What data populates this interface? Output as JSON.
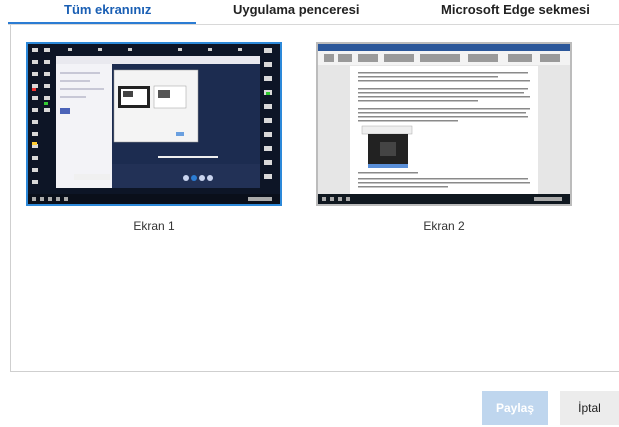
{
  "tabs": [
    {
      "label": "Tüm ekranınız",
      "selected": true
    },
    {
      "label": "Uygulama penceresi",
      "selected": false
    },
    {
      "label": "Microsoft Edge sekmesi",
      "selected": false
    }
  ],
  "screens": [
    {
      "label": "Ekran 1",
      "selected": true
    },
    {
      "label": "Ekran 2",
      "selected": false
    }
  ],
  "buttons": {
    "share_label": "Paylaş",
    "cancel_label": "İptal"
  },
  "colors": {
    "accent": "#2b7cd3",
    "share_disabled": "#bfd6ee"
  }
}
